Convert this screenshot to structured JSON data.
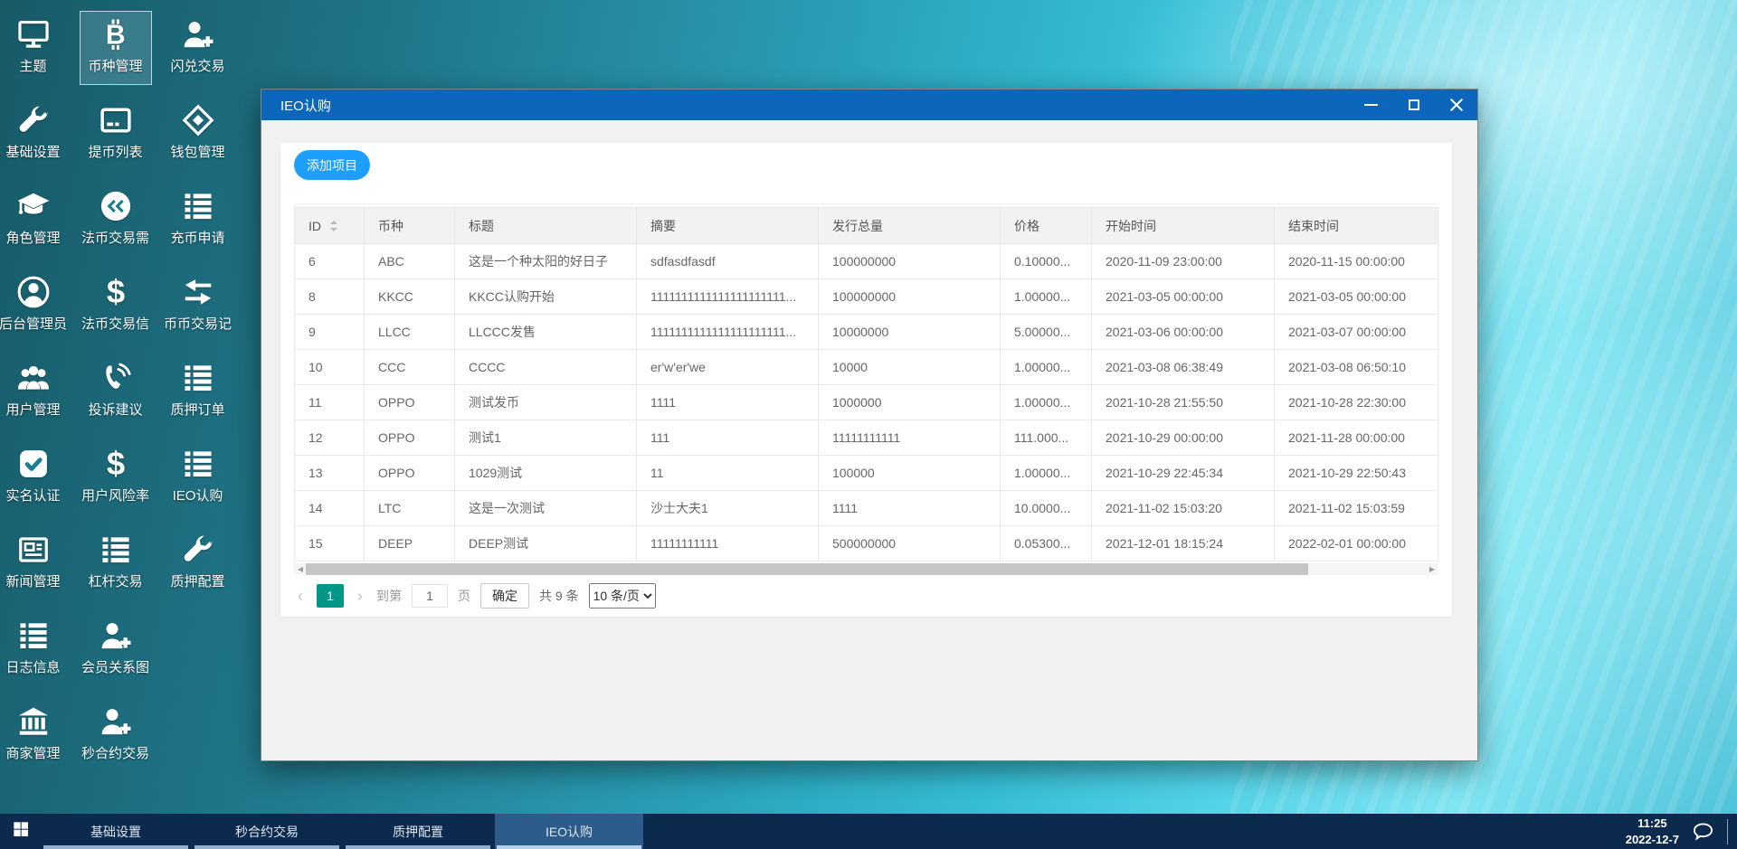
{
  "desktop": {
    "columns": [
      {
        "items": [
          {
            "id": "theme",
            "label": "主题",
            "icon": "monitor"
          },
          {
            "id": "basic-settings",
            "label": "基础设置",
            "icon": "wrench"
          },
          {
            "id": "role-management",
            "label": "角色管理",
            "icon": "graduation-cap"
          },
          {
            "id": "admin-manager",
            "label": "后台管理员",
            "icon": "user-circle"
          },
          {
            "id": "user-management",
            "label": "用户管理",
            "icon": "users"
          },
          {
            "id": "realname-auth",
            "label": "实名认证",
            "icon": "check-square"
          },
          {
            "id": "news-management",
            "label": "新闻管理",
            "icon": "news"
          },
          {
            "id": "log-info",
            "label": "日志信息",
            "icon": "list"
          },
          {
            "id": "merchant-management",
            "label": "商家管理",
            "icon": "bank"
          }
        ]
      },
      {
        "items": [
          {
            "id": "coin-management",
            "label": "币种管理",
            "icon": "bitcoin",
            "selected": true
          },
          {
            "id": "withdraw-list",
            "label": "提币列表",
            "icon": "credit-card"
          },
          {
            "id": "fiat-trade-demand",
            "label": "法币交易需",
            "icon": "coin"
          },
          {
            "id": "fiat-trade-info",
            "label": "法币交易信",
            "icon": "dollar"
          },
          {
            "id": "complaint-suggest",
            "label": "投诉建议",
            "icon": "phone"
          },
          {
            "id": "user-risk-rate",
            "label": "用户风险率",
            "icon": "dollar"
          },
          {
            "id": "leverage-trade",
            "label": "杠杆交易",
            "icon": "list"
          },
          {
            "id": "member-relation",
            "label": "会员关系图",
            "icon": "user-plus"
          },
          {
            "id": "second-contract",
            "label": "秒合约交易",
            "icon": "user-plus"
          }
        ]
      },
      {
        "items": [
          {
            "id": "flash-exchange",
            "label": "闪兑交易",
            "icon": "user-plus"
          },
          {
            "id": "wallet-management",
            "label": "钱包管理",
            "icon": "gem"
          },
          {
            "id": "deposit-apply",
            "label": "充币申请",
            "icon": "list"
          },
          {
            "id": "coin-trade-record",
            "label": "币币交易记",
            "icon": "swap"
          },
          {
            "id": "pledge-order",
            "label": "质押订单",
            "icon": "list"
          },
          {
            "id": "ieo-subscribe",
            "label": "IEO认购",
            "icon": "list"
          },
          {
            "id": "pledge-config",
            "label": "质押配置",
            "icon": "wrench"
          }
        ]
      }
    ]
  },
  "window": {
    "title": "IEO认购",
    "controls": [
      "minimize-icon",
      "maximize-icon",
      "close-icon"
    ],
    "toolbar": {
      "add_button": "添加项目"
    },
    "table": {
      "columns": [
        "ID",
        "币种",
        "标题",
        "摘要",
        "发行总量",
        "价格",
        "开始时间",
        "结束时间"
      ],
      "sort_icon_column": "ID",
      "rows": [
        [
          "6",
          "ABC",
          "这是一个种太阳的好日子",
          "sdfasdfasdf",
          "100000000",
          "0.10000...",
          "2020-11-09 23:00:00",
          "2020-11-15 00:00:00"
        ],
        [
          "8",
          "KKCC",
          "KKCC认购开始",
          "1111111111111111111111...",
          "100000000",
          "1.00000...",
          "2021-03-05 00:00:00",
          "2021-03-05 00:00:00"
        ],
        [
          "9",
          "LLCC",
          "LLCCC发售",
          "1111111111111111111111...",
          "10000000",
          "5.00000...",
          "2021-03-06 00:00:00",
          "2021-03-07 00:00:00"
        ],
        [
          "10",
          "CCC",
          "CCCC",
          "er'w'er'we",
          "10000",
          "1.00000...",
          "2021-03-08 06:38:49",
          "2021-03-08 06:50:10"
        ],
        [
          "11",
          "OPPO",
          "测试发币",
          "1111",
          "1000000",
          "1.00000...",
          "2021-10-28 21:55:50",
          "2021-10-28 22:30:00"
        ],
        [
          "12",
          "OPPO",
          "测试1",
          "111",
          "11111111111",
          "111.000...",
          "2021-10-29 00:00:00",
          "2021-11-28 00:00:00"
        ],
        [
          "13",
          "OPPO",
          "1029测试",
          "11",
          "100000",
          "1.00000...",
          "2021-10-29 22:45:34",
          "2021-10-29 22:50:43"
        ],
        [
          "14",
          "LTC",
          "这是一次测试",
          "沙士大夫1",
          "1111",
          "10.0000...",
          "2021-11-02 15:03:20",
          "2021-11-02 15:03:59"
        ],
        [
          "15",
          "DEEP",
          "DEEP测试",
          "11111111111",
          "500000000",
          "0.05300...",
          "2021-12-01 18:15:24",
          "2022-02-01 00:00:00"
        ]
      ]
    },
    "pagination": {
      "prev_icon": "chevron-left",
      "next_icon": "chevron-right",
      "prev": "‹",
      "next": "›",
      "current_page": "1",
      "goto_label": "到第",
      "goto_value": "1",
      "page_suffix": "页",
      "confirm_label": "确定",
      "total_label": "共 9 条",
      "per_page_label": "10 条/页"
    }
  },
  "taskbar": {
    "start_icon": "windows-logo",
    "items": [
      {
        "label": "基础设置",
        "active": false
      },
      {
        "label": "秒合约交易",
        "active": false
      },
      {
        "label": "质押配置",
        "active": false
      },
      {
        "label": "IEO认购",
        "active": true
      }
    ],
    "clock": {
      "time": "11:25",
      "date": "2022-12-7"
    },
    "tray_icon": "chat-bubble"
  },
  "colors": {
    "titlebar_blue": "#0c66bb",
    "accent_blue": "#1e9fff",
    "pager_green": "#009688",
    "taskbar_navy": "#0c2a4d"
  }
}
